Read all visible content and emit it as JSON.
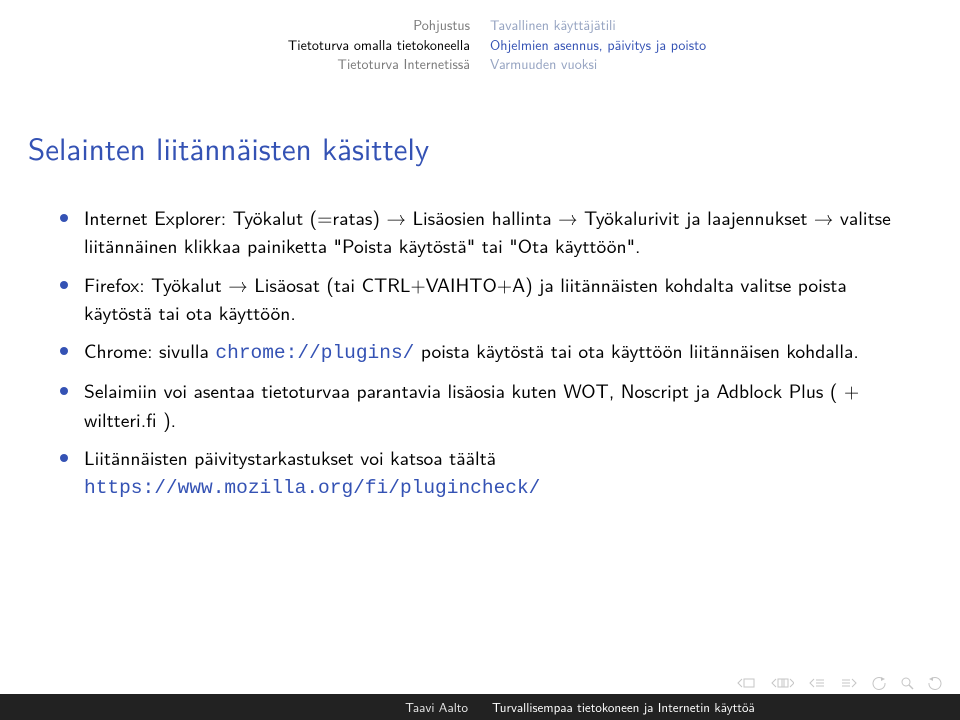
{
  "nav": {
    "left": [
      {
        "text": "Pohjustus",
        "active": false
      },
      {
        "text": "Tietoturva omalla tietokoneella",
        "active": true
      },
      {
        "text": "Tietoturva Internetissä",
        "active": false
      }
    ],
    "right": [
      {
        "text": "Tavallinen käyttäjätili",
        "active": false
      },
      {
        "text": "Ohjelmien asennus, päivitys ja poisto",
        "active": true
      },
      {
        "text": "Varmuuden vuoksi",
        "active": false
      }
    ]
  },
  "title": "Selainten liitännäisten käsittely",
  "bullets": {
    "b1a": "Internet Explorer: Työkalut (=ratas) → Lisäosien hallinta → Työkalurivit ja laajennukset → valitse liitännäinen klikkaa painiketta \"Poista käytöstä\" tai \"Ota käyttöön\".",
    "b2a": "Firefox: Työkalut → Lisäosat (tai CTRL+VAIHTO+A) ja liitännäisten kohdalta valitse poista käytöstä tai ota käyttöön.",
    "b3a": "Chrome: sivulla ",
    "b3url": "chrome://plugins/",
    "b3b": " poista käytöstä tai ota käyttöön liitännäisen kohdalla.",
    "b4a": "Selaimiin voi asentaa tietoturvaa parantavia lisäosia kuten WOT, Noscript ja Adblock Plus ( + wiltteri.fi ).",
    "b5a": "Liitännäisten päivitystarkastukset voi katsoa täältä",
    "b5url": "https://www.mozilla.org/fi/plugincheck/"
  },
  "footer": {
    "author": "Taavi Aalto",
    "presentation": "Turvallisempaa tietokoneen ja Internetin käyttöä"
  }
}
